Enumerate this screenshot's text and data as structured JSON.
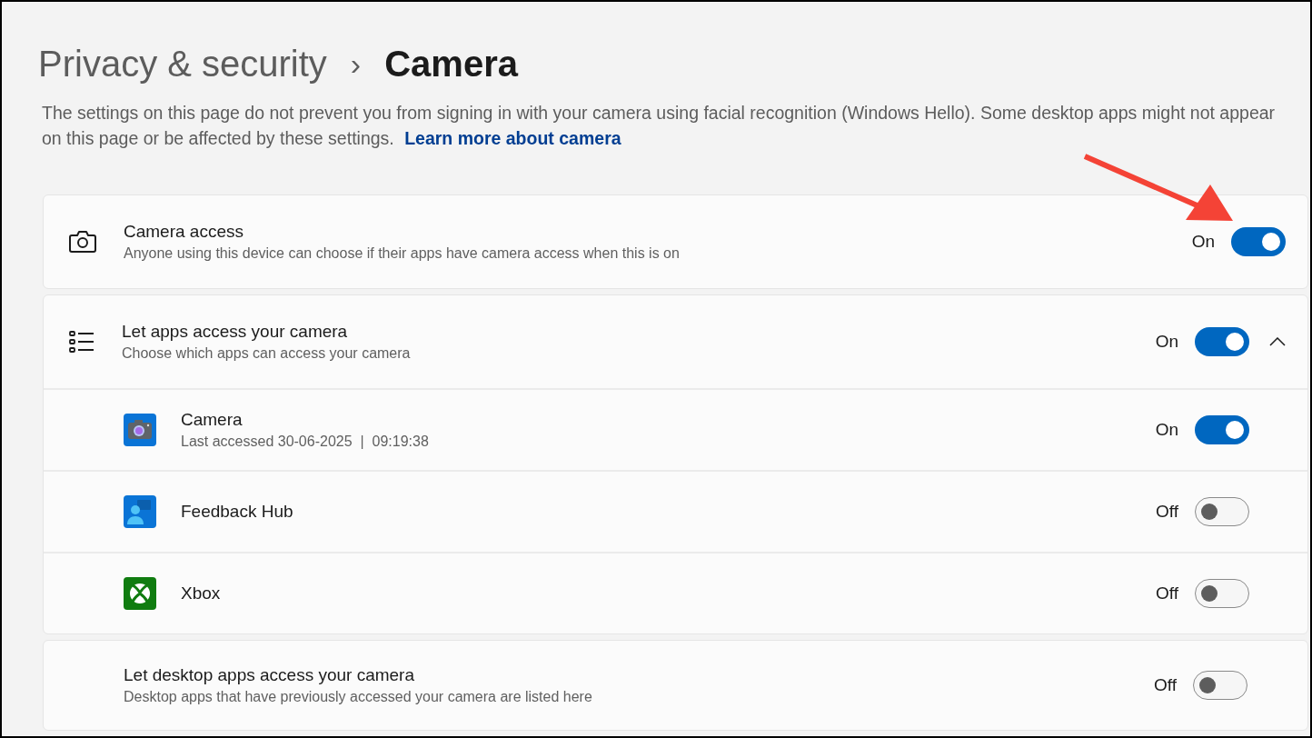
{
  "breadcrumb": {
    "parent": "Privacy & security",
    "separator": "›",
    "current": "Camera"
  },
  "description": {
    "text": "The settings on this page do not prevent you from signing in with your camera using facial recognition (Windows Hello). Some desktop apps might not appear on this page or be affected by these settings.",
    "link": "Learn more about camera"
  },
  "settings": [
    {
      "kind": "access",
      "title": "Camera access",
      "subtitle": "Anyone using this device can choose if their apps have camera access when this is on",
      "state_label": "On",
      "on": true
    },
    {
      "kind": "expander",
      "title": "Let apps access your camera",
      "subtitle": "Choose which apps can access your camera",
      "state_label": "On",
      "on": true,
      "expanded": true,
      "apps": [
        {
          "name": "Camera",
          "detail": "Last accessed 30-06-2025  |  09:19:38",
          "state_label": "On",
          "on": true
        },
        {
          "name": "Feedback Hub",
          "state_label": "Off",
          "on": false
        },
        {
          "name": "Xbox",
          "state_label": "Off",
          "on": false
        }
      ]
    },
    {
      "kind": "plain",
      "title": "Let desktop apps access your camera",
      "subtitle": "Desktop apps that have previously accessed your camera are listed here",
      "state_label": "Off",
      "on": false
    }
  ]
}
